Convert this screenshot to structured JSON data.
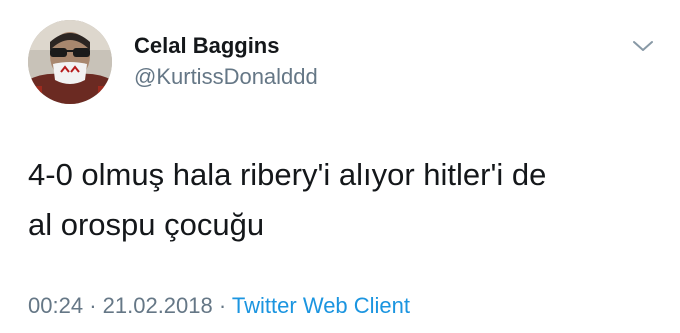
{
  "user": {
    "display_name": "Celal Baggins",
    "handle": "@KurtissDonalddd"
  },
  "tweet": {
    "text_lines": [
      "4-0 olmuş hala ribery'i alıyor hitler'i de",
      "al orospu çocuğu"
    ],
    "time": "00:24",
    "separator": "·",
    "date": "21.02.2018",
    "source": "Twitter Web Client"
  },
  "icons": {
    "menu": "chevron-down-icon",
    "avatar": "avatar"
  },
  "colors": {
    "text": "#14171a",
    "secondary": "#657786",
    "link": "#1b95e0"
  }
}
